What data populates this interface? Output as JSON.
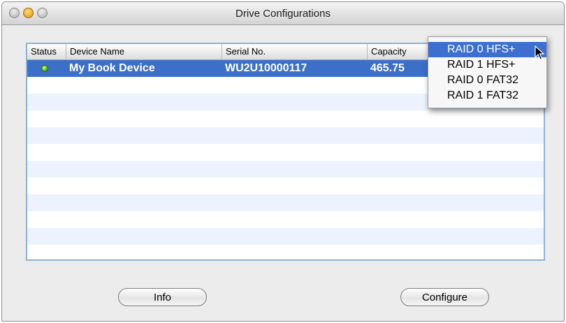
{
  "window": {
    "title": "Drive Configurations"
  },
  "table": {
    "columns": [
      "Status",
      "Device Name",
      "Serial No.",
      "Capacity"
    ],
    "rows": [
      {
        "status_icon": "green-status-led-icon",
        "device_name": "My Book Device",
        "serial_no": "WU2U10000117",
        "capacity": "465.75",
        "selected": true
      }
    ]
  },
  "buttons": {
    "info": "Info",
    "configure": "Configure"
  },
  "dropdown": {
    "items": [
      "RAID 0 HFS+",
      "RAID 1 HFS+",
      "RAID 0 FAT32",
      "RAID 1 FAT32"
    ],
    "highlighted": "RAID 0 HFS+"
  },
  "colors": {
    "selection": "#3c6fc8",
    "menu_highlight": "#3d6fd0",
    "table_border": "#8fb1d6",
    "status_led": "#3fa70f"
  }
}
